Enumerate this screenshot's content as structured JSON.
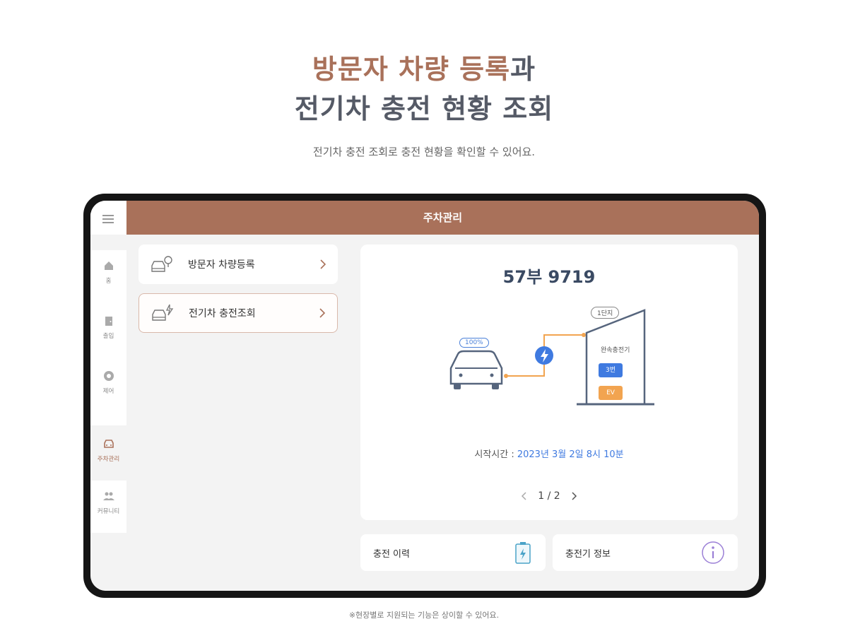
{
  "hero": {
    "title_line1_part1": "방문자 차량 등록",
    "title_line1_part2": "과",
    "title_line2": "전기차 충전 현황 조회",
    "subtitle": "전기차 충전 조회로 충전 현황을 확인할 수 있어요."
  },
  "app": {
    "topbar_title": "주차관리",
    "rail": [
      {
        "label": "홈",
        "icon": "home-icon"
      },
      {
        "label": "출입",
        "icon": "door-icon"
      },
      {
        "label": "제어",
        "icon": "control-icon"
      },
      {
        "label": "주차관리",
        "icon": "car-icon",
        "active": true
      },
      {
        "label": "커뮤니티",
        "icon": "community-icon"
      }
    ],
    "menu": [
      {
        "label": "방문자 차량등록",
        "icon": "car-pin-icon"
      },
      {
        "label": "전기차 충전조회",
        "icon": "car-charge-icon",
        "active": true
      }
    ],
    "charging": {
      "plate": "57부 9719",
      "battery_percent": "100%",
      "zone": "1단지",
      "charger_name": "완속충전기",
      "tag_blue": "3번",
      "tag_orange": "EV",
      "start_label": "시작시간 : ",
      "start_value": "2023년 3월 2일 8시 10분",
      "pager": "1 / 2"
    },
    "cards": {
      "history": "충전 이력",
      "info": "충전기 정보"
    }
  },
  "footnote": "※현장별로 지원되는 기능은 상이할 수 있어요.",
  "colors": {
    "accent": "#a9715a",
    "blue": "#3f7ae0",
    "orange": "#f2a450"
  }
}
